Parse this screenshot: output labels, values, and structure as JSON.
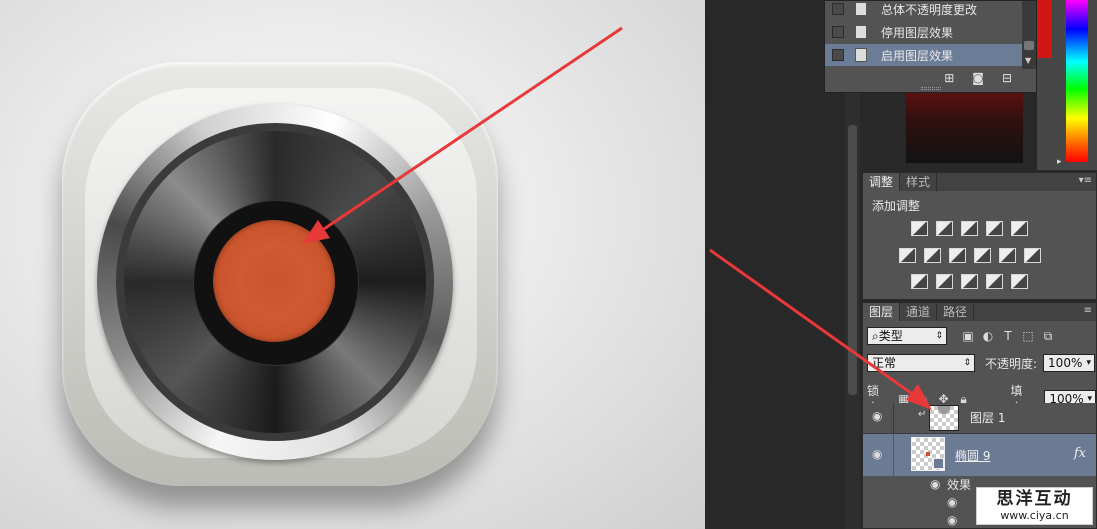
{
  "history": {
    "items": [
      {
        "label": "总体不透明度更改",
        "selected": false
      },
      {
        "label": "停用图层效果",
        "selected": false
      },
      {
        "label": "启用图层效果",
        "selected": true
      }
    ],
    "tools": [
      "new-snapshot-icon",
      "camera-icon",
      "trash-icon"
    ]
  },
  "adjustments": {
    "tabs": [
      "调整",
      "样式"
    ],
    "active_tab": "调整",
    "title": "添加调整"
  },
  "layers": {
    "tabs": [
      "图层",
      "通道",
      "路径"
    ],
    "active_tab": "图层",
    "filter_label": "类型",
    "blend_mode": "正常",
    "opacity_label": "不透明度:",
    "opacity_value": "100%",
    "lock_label": "锁定",
    "fill_label": "填充:",
    "fill_value": "100%",
    "rows": [
      {
        "name": "图层 1"
      },
      {
        "name": "椭圆 9",
        "fx": "fx"
      }
    ],
    "effects_label": "效果"
  },
  "watermark": {
    "title": "思洋互动",
    "url": "www.ciya.cn"
  },
  "colors": {
    "panel_bg": "#535353",
    "selection": "#6c7b94",
    "record_label": "#c8552f",
    "arrow": "#e8383a"
  }
}
